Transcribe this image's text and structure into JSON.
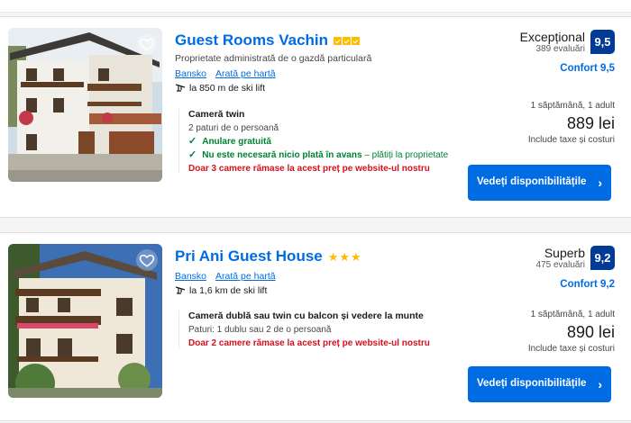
{
  "colors": {
    "link": "#006ce4",
    "badge": "#003b95",
    "button": "#006ce4",
    "green": "#008234",
    "red": "#d4111e",
    "star": "#febb02"
  },
  "listings": [
    {
      "name": "Guest Rooms Vachin",
      "rating_icon": "quality-square",
      "rating_count": 3,
      "subtitle": "Proprietate administrată de o gazdă particulară",
      "location": "Bansko",
      "map_link": "Arată pe hartă",
      "distance": "la 850 m de ski lift",
      "room_title": "Cameră twin",
      "room_beds": "2 paturi de o persoană",
      "perk_1": "Anulare gratuită",
      "perk_2_bold": "Nu este necesară nicio plată în avans",
      "perk_2_rest": "– plătiți la proprietate",
      "urgency": "Doar 3 camere rămase la acest preț pe website-ul nostru",
      "score_word": "Excepțional",
      "reviews": "389 evaluări",
      "score": "9,5",
      "comfort": "Confort 9,5",
      "stay": "1 săptămână, 1 adult",
      "price": "889 lei",
      "taxes": "Include taxe și costuri",
      "button": "Vedeți disponibilitățile"
    },
    {
      "name": "Pri Ani Guest House",
      "rating_icon": "star",
      "rating_count": 3,
      "location": "Bansko",
      "map_link": "Arată pe hartă",
      "distance": "la 1,6 km de ski lift",
      "room_title": "Cameră dublă sau twin cu balcon și vedere la munte",
      "room_beds": "Paturi: 1 dublu sau 2 de o persoană",
      "urgency": "Doar 2 camere rămase la acest preț pe website-ul nostru",
      "score_word": "Superb",
      "reviews": "475 evaluări",
      "score": "9,2",
      "comfort": "Confort 9,2",
      "stay": "1 săptămână, 1 adult",
      "price": "890 lei",
      "taxes": "Include taxe și costuri",
      "button": "Vedeți disponibilitățile"
    }
  ]
}
